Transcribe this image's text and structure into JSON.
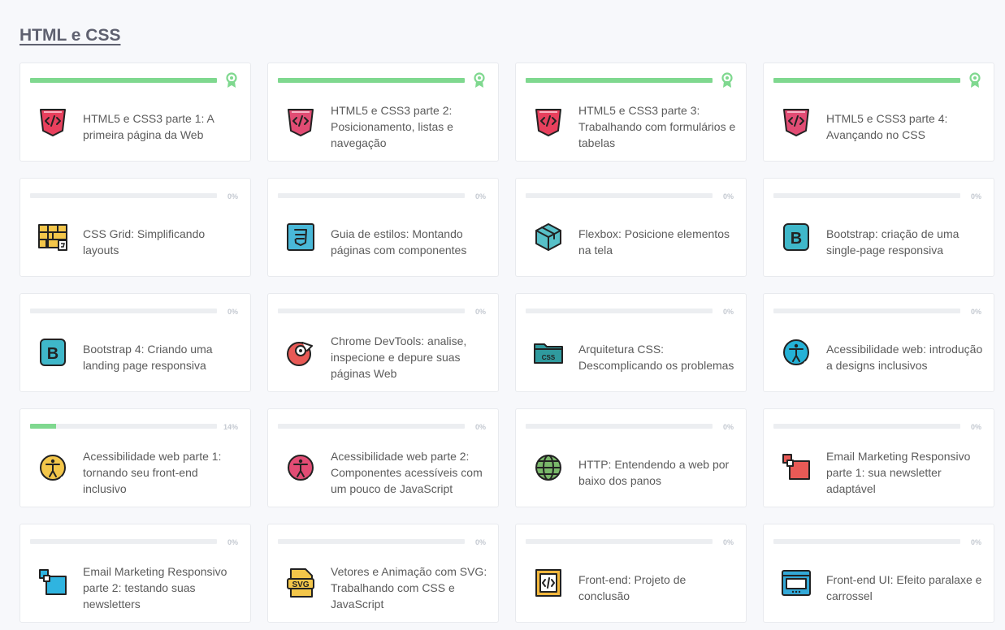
{
  "section": {
    "title": "HTML e CSS"
  },
  "colors": {
    "progress": "#7fd88f",
    "track": "#eceef1",
    "badge": "#7fd88f"
  },
  "courses": [
    {
      "name": "HTML5 e CSS3 parte 1: A primeira página da Web",
      "progress": 100,
      "progress_label": "",
      "completed": true,
      "icon": "html-tag-icon"
    },
    {
      "name": "HTML5 e CSS3 parte 2: Posicionamento, listas e navegação",
      "progress": 100,
      "progress_label": "",
      "completed": true,
      "icon": "html-tag-icon"
    },
    {
      "name": "HTML5 e CSS3 parte 3: Trabalhando com formulários e tabelas",
      "progress": 100,
      "progress_label": "",
      "completed": true,
      "icon": "html-tag-icon"
    },
    {
      "name": "HTML5 e CSS3 parte 4: Avançando no CSS",
      "progress": 100,
      "progress_label": "",
      "completed": true,
      "icon": "html-tag-icon"
    },
    {
      "name": "CSS Grid: Simplificando layouts",
      "progress": 0,
      "progress_label": "0%",
      "completed": false,
      "icon": "css-grid-icon"
    },
    {
      "name": "Guia de estilos: Montando páginas com componentes",
      "progress": 0,
      "progress_label": "0%",
      "completed": false,
      "icon": "css3-shield-icon"
    },
    {
      "name": "Flexbox: Posicione elementos na tela",
      "progress": 0,
      "progress_label": "0%",
      "completed": false,
      "icon": "box-icon"
    },
    {
      "name": "Bootstrap: criação de uma single-page responsiva",
      "progress": 0,
      "progress_label": "0%",
      "completed": false,
      "icon": "bootstrap-icon"
    },
    {
      "name": "Bootstrap 4: Criando uma landing page responsiva",
      "progress": 0,
      "progress_label": "0%",
      "completed": false,
      "icon": "bootstrap-icon"
    },
    {
      "name": "Chrome DevTools: analise, inspecione e depure suas páginas Web",
      "progress": 0,
      "progress_label": "0%",
      "completed": false,
      "icon": "chrome-devtools-icon"
    },
    {
      "name": "Arquitetura CSS: Descomplicando os problemas",
      "progress": 0,
      "progress_label": "0%",
      "completed": false,
      "icon": "css-folder-icon"
    },
    {
      "name": "Acessibilidade web: introdução a designs inclusivos",
      "progress": 0,
      "progress_label": "0%",
      "completed": false,
      "icon": "accessibility-icon"
    },
    {
      "name": "Acessibilidade web parte 1: tornando seu front-end inclusivo",
      "progress": 14,
      "progress_label": "14%",
      "completed": false,
      "icon": "accessibility-icon"
    },
    {
      "name": "Acessibilidade web parte 2: Componentes acessíveis com um pouco de JavaScript",
      "progress": 0,
      "progress_label": "0%",
      "completed": false,
      "icon": "accessibility-icon"
    },
    {
      "name": "HTTP: Entendendo a web por baixo dos panos",
      "progress": 0,
      "progress_label": "0%",
      "completed": false,
      "icon": "globe-icon"
    },
    {
      "name": "Email Marketing Responsivo parte 1: sua newsletter adaptável",
      "progress": 0,
      "progress_label": "0%",
      "completed": false,
      "icon": "responsive-squares-icon"
    },
    {
      "name": "Email Marketing Responsivo parte 2: testando suas newsletters",
      "progress": 0,
      "progress_label": "0%",
      "completed": false,
      "icon": "responsive-squares-icon"
    },
    {
      "name": "Vetores e Animação com SVG: Trabalhando com CSS e JavaScript",
      "progress": 0,
      "progress_label": "0%",
      "completed": false,
      "icon": "svg-file-icon"
    },
    {
      "name": "Front-end: Projeto de conclusão",
      "progress": 0,
      "progress_label": "0%",
      "completed": false,
      "icon": "code-file-icon"
    },
    {
      "name": "Front-end UI: Efeito paralaxe e carrossel",
      "progress": 0,
      "progress_label": "0%",
      "completed": false,
      "icon": "browser-window-icon"
    }
  ]
}
